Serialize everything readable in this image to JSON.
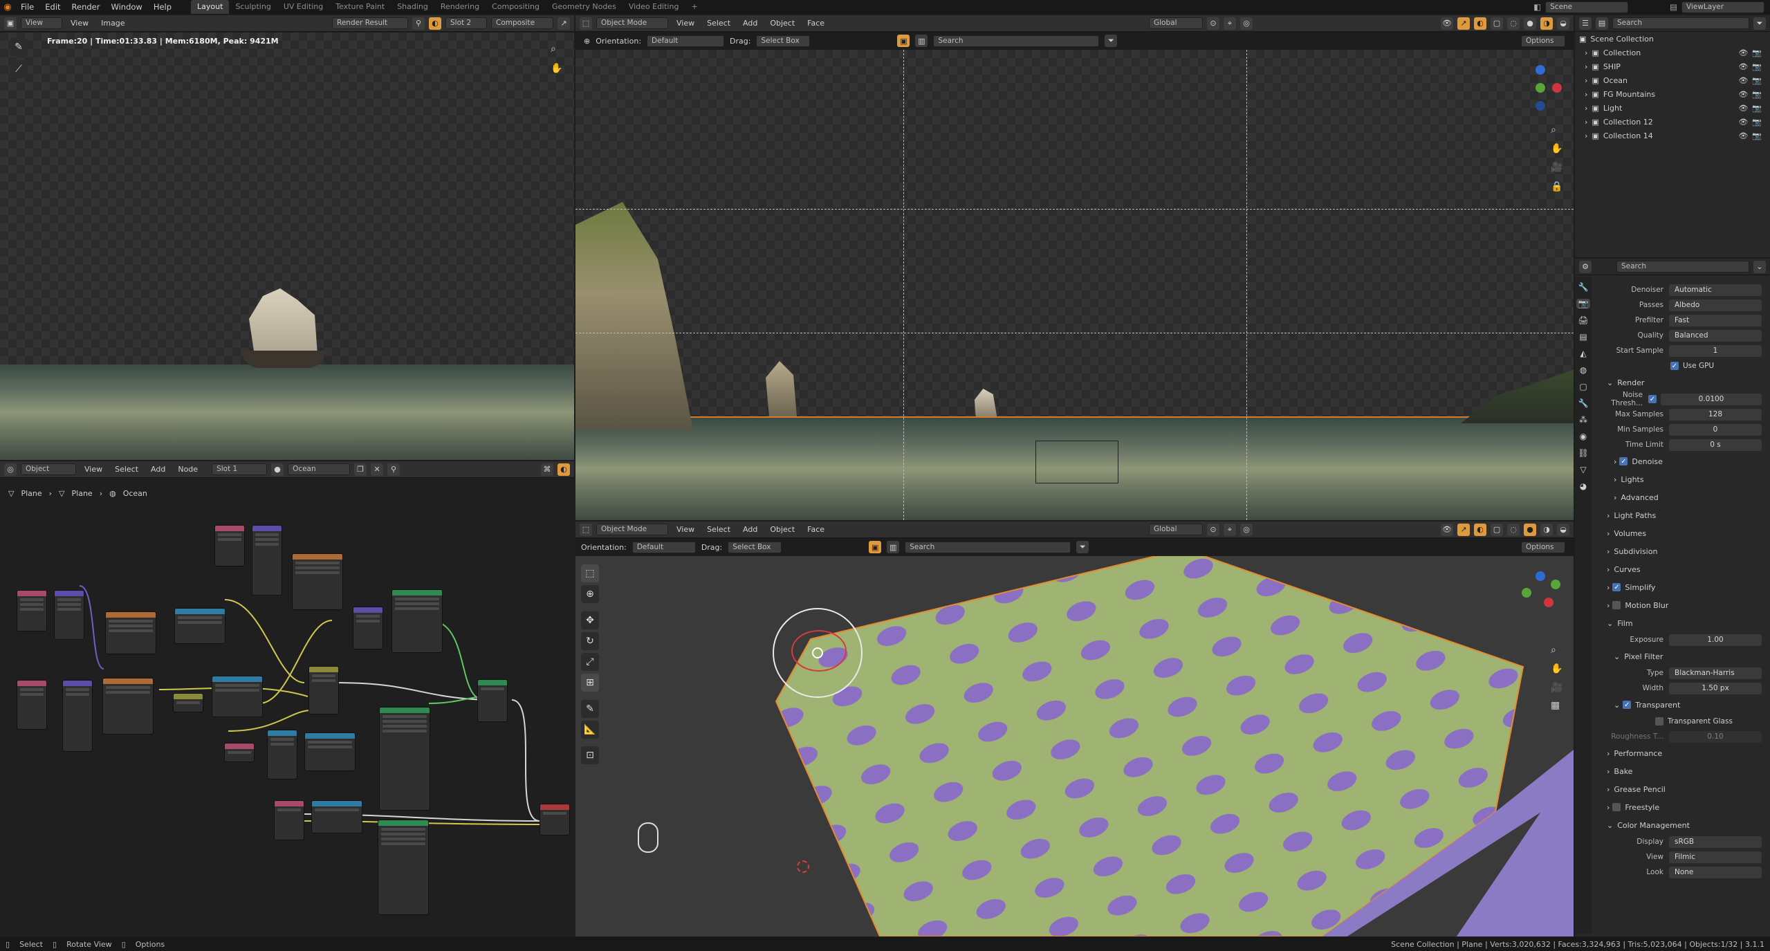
{
  "menu": [
    "File",
    "Edit",
    "Render",
    "Window",
    "Help"
  ],
  "workspaces": [
    "Layout",
    "Sculpting",
    "UV Editing",
    "Texture Paint",
    "Shading",
    "Rendering",
    "Compositing",
    "Geometry Nodes",
    "Video Editing"
  ],
  "scene": {
    "name": "Scene",
    "view_layer": "ViewLayer"
  },
  "image_editor": {
    "view": "View",
    "menus": [
      "View",
      "Image"
    ],
    "image": "Render Result",
    "slot": "Slot 2",
    "layer": "Composite",
    "info": "Frame:20 | Time:01:33.83 | Mem:6180M, Peak: 9421M"
  },
  "node_editor": {
    "mode": "Object",
    "menus": [
      "View",
      "Select",
      "Add",
      "Node"
    ],
    "slot": "Slot 1",
    "material": "Ocean",
    "breadcrumb": [
      "Plane",
      "Plane",
      "Ocean"
    ]
  },
  "viewport_top": {
    "mode": "Object Mode",
    "menus": [
      "View",
      "Select",
      "Add",
      "Object",
      "Face"
    ],
    "orientation_label": "Orientation:",
    "orientation": "Default",
    "drag_label": "Drag:",
    "drag": "Select Box",
    "transform": "Global",
    "options": "Options",
    "search_placeholder": "Search"
  },
  "viewport_bottom": {
    "mode": "Object Mode",
    "menus": [
      "View",
      "Select",
      "Add",
      "Object",
      "Face"
    ],
    "orientation_label": "Orientation:",
    "orientation": "Default",
    "drag_label": "Drag:",
    "drag": "Select Box",
    "transform": "Global",
    "options": "Options",
    "search_placeholder": "Search"
  },
  "outliner": {
    "root": "Scene Collection",
    "items": [
      "Collection",
      "SHIP",
      "Ocean",
      "FG Mountains",
      "Light",
      "Collection 12",
      "Collection 14"
    ],
    "search_placeholder": "Search"
  },
  "properties": {
    "search_placeholder": "Search",
    "denoise_section": [
      {
        "label": "Denoiser",
        "value": "Automatic"
      },
      {
        "label": "Passes",
        "value": "Albedo"
      },
      {
        "label": "Prefilter",
        "value": "Fast"
      },
      {
        "label": "Quality",
        "value": "Balanced"
      },
      {
        "label": "Start Sample",
        "value": "1"
      }
    ],
    "use_gpu": "Use GPU",
    "render_header": "Render",
    "render_rows": [
      {
        "label": "Noise Thresh...",
        "value": "0.0100"
      },
      {
        "label": "Max Samples",
        "value": "128"
      },
      {
        "label": "Min Samples",
        "value": "0"
      },
      {
        "label": "Time Limit",
        "value": "0 s"
      }
    ],
    "render_sub": [
      "Denoise",
      "Lights",
      "Advanced"
    ],
    "panels": [
      "Light Paths",
      "Volumes",
      "Subdivision",
      "Curves",
      "Simplify",
      "Motion Blur",
      "Film"
    ],
    "film_rows": [
      {
        "label": "Exposure",
        "value": "1.00"
      }
    ],
    "pixel_filter": "Pixel Filter",
    "pixel_filter_rows": [
      {
        "label": "Type",
        "value": "Blackman-Harris"
      },
      {
        "label": "Width",
        "value": "1.50 px"
      }
    ],
    "transparent": "Transparent",
    "transparent_glass": "Transparent Glass",
    "roughness": {
      "label": "Roughness T...",
      "value": "0.10"
    },
    "panels2": [
      "Performance",
      "Bake",
      "Grease Pencil",
      "Freestyle",
      "Color Management"
    ],
    "color_rows": [
      {
        "label": "Display",
        "value": "sRGB"
      },
      {
        "label": "View",
        "value": "Filmic"
      },
      {
        "label": "Look",
        "value": "None"
      }
    ]
  },
  "statusbar": {
    "left": [
      "Select",
      "Rotate View",
      "Options"
    ],
    "right": "Scene Collection | Plane | Verts:3,020,632 | Faces:3,324,963 | Tris:5,023,064 | Objects:1/32 | 3.1.1"
  },
  "colors": {
    "accent": "#4772b3",
    "active_tool": "#e09a3e",
    "terrain": "#9fb472",
    "terrain_spots": "#8a6fc2",
    "base": "#8b7bc4"
  }
}
